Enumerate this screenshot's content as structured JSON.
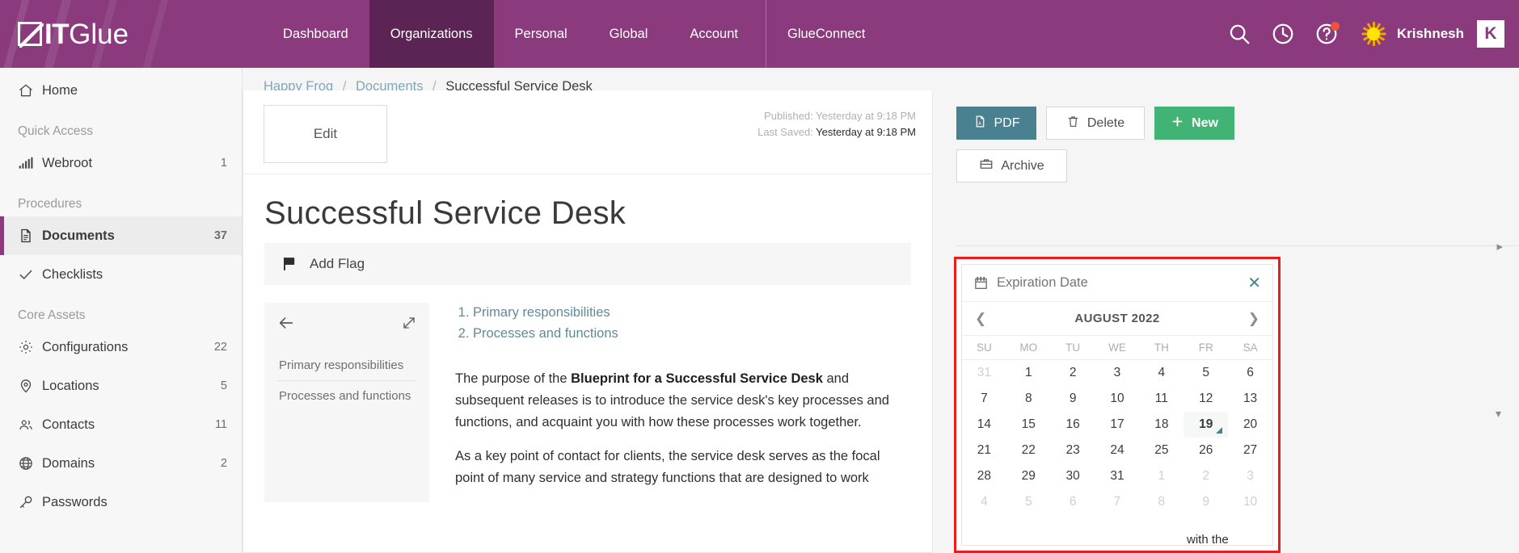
{
  "brand": {
    "logo_it": "IT",
    "logo_glue": "Glue",
    "accent_purple": "#8a3a7d",
    "accent_purple_dark": "#5c2454",
    "accent_teal": "#4a8190",
    "accent_green": "#40b375",
    "highlight_red": "#ee1b1b"
  },
  "topnav": {
    "items": [
      {
        "label": "Dashboard",
        "active": false
      },
      {
        "label": "Organizations",
        "active": true
      },
      {
        "label": "Personal",
        "active": false
      },
      {
        "label": "Global",
        "active": false
      },
      {
        "label": "Account",
        "active": false
      },
      {
        "label": "GlueConnect",
        "active": false
      }
    ],
    "icons": [
      "search-icon",
      "history-clock-icon",
      "help-question-icon"
    ],
    "username": "Krishnesh",
    "user_badge": "K"
  },
  "sidebar": {
    "home": {
      "label": "Home",
      "icon": "home-icon"
    },
    "groups": [
      {
        "heading": "Quick Access",
        "items": [
          {
            "label": "Webroot",
            "count": "1",
            "icon": "bars-chart-icon"
          }
        ]
      },
      {
        "heading": "Procedures",
        "items": [
          {
            "label": "Documents",
            "count": "37",
            "icon": "document-icon",
            "active": true
          },
          {
            "label": "Checklists",
            "count": "",
            "icon": "check-icon",
            "active": false
          }
        ]
      },
      {
        "heading": "Core Assets",
        "items": [
          {
            "label": "Configurations",
            "count": "22",
            "icon": "gear-icon"
          },
          {
            "label": "Locations",
            "count": "5",
            "icon": "map-pin-icon"
          },
          {
            "label": "Contacts",
            "count": "11",
            "icon": "people-icon"
          },
          {
            "label": "Domains",
            "count": "2",
            "icon": "globe-icon"
          },
          {
            "label": "Passwords",
            "count": "",
            "icon": "key-icon"
          }
        ]
      }
    ]
  },
  "breadcrumb": {
    "org": "Happy Frog",
    "section": "Documents",
    "current": "Successful Service Desk",
    "separator": "/"
  },
  "document": {
    "edit_label": "Edit",
    "meta": {
      "published_label": "Published:",
      "published_value": "Yesterday at 9:18 PM",
      "last_saved_label": "Last Saved:",
      "last_saved_value": "Yesterday at 9:18 PM"
    },
    "title": "Successful Service Desk",
    "flag_label": "Add Flag",
    "toc": {
      "back_icon": "arrow-left-icon",
      "expand_icon": "expand-diagonal-icon",
      "items": [
        "Primary responsibilities",
        "Processes and functions"
      ]
    },
    "list": [
      "Primary responsibilities",
      "Processes and functions"
    ],
    "paragraph_1_pre": "The purpose of the ",
    "paragraph_1_bold": "Blueprint for a Successful Service Desk",
    "paragraph_1_post": "  and subsequent releases is to introduce the service desk's key processes and functions, and acquaint you with how these processes work together.",
    "paragraph_2": "As a key point of contact for clients, the service desk serves as the focal point of many service and strategy functions that are designed to work",
    "cut_text": "with the"
  },
  "actions": {
    "pdf": {
      "label": "PDF",
      "icon": "pdf-file-icon"
    },
    "delete": {
      "label": "Delete",
      "icon": "trash-icon"
    },
    "new": {
      "label": "New",
      "icon": "plus-icon"
    },
    "archive": {
      "label": "Archive",
      "icon": "archive-box-icon"
    }
  },
  "expiration_picker": {
    "field_icon": "calendar-icon",
    "placeholder": "Expiration Date",
    "value": "",
    "clear_icon": "close-icon",
    "prev_icon": "chevron-left-icon",
    "next_icon": "chevron-right-icon",
    "month_label": "AUGUST 2022",
    "weekdays": [
      "SU",
      "MO",
      "TU",
      "WE",
      "TH",
      "FR",
      "SA"
    ],
    "days": [
      {
        "n": "31",
        "mute": true
      },
      {
        "n": "1"
      },
      {
        "n": "2"
      },
      {
        "n": "3"
      },
      {
        "n": "4"
      },
      {
        "n": "5"
      },
      {
        "n": "6"
      },
      {
        "n": "7"
      },
      {
        "n": "8"
      },
      {
        "n": "9"
      },
      {
        "n": "10"
      },
      {
        "n": "11"
      },
      {
        "n": "12"
      },
      {
        "n": "13"
      },
      {
        "n": "14"
      },
      {
        "n": "15"
      },
      {
        "n": "16"
      },
      {
        "n": "17"
      },
      {
        "n": "18"
      },
      {
        "n": "19",
        "today": true
      },
      {
        "n": "20"
      },
      {
        "n": "21"
      },
      {
        "n": "22"
      },
      {
        "n": "23"
      },
      {
        "n": "24"
      },
      {
        "n": "25"
      },
      {
        "n": "26"
      },
      {
        "n": "27"
      },
      {
        "n": "28"
      },
      {
        "n": "29"
      },
      {
        "n": "30"
      },
      {
        "n": "31"
      },
      {
        "n": "1",
        "mute": true
      },
      {
        "n": "2",
        "mute": true
      },
      {
        "n": "3",
        "mute": true
      },
      {
        "n": "4",
        "mute": true
      },
      {
        "n": "5",
        "mute": true
      },
      {
        "n": "6",
        "mute": true
      },
      {
        "n": "7",
        "mute": true
      },
      {
        "n": "8",
        "mute": true
      },
      {
        "n": "9",
        "mute": true
      },
      {
        "n": "10",
        "mute": true
      }
    ]
  }
}
